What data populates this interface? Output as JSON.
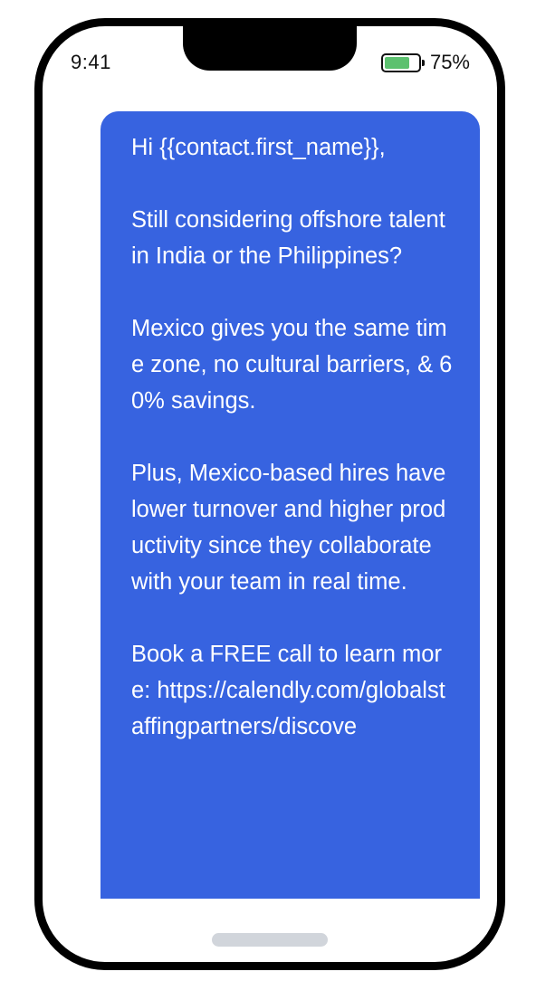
{
  "status_bar": {
    "time": "9:41",
    "battery_percent_label": "75%",
    "battery_level": 0.75,
    "battery_color": "#5cc16f"
  },
  "message": {
    "bubble_color": "#3763e0",
    "paragraphs": [
      "Hi {{contact.first_name}},",
      "Still considering offshore talent in India or the Philippines?",
      "Mexico gives you the same time zone, no cultural barriers, & 60% savings.",
      "Plus, Mexico-based hires have lower turnover and higher productivity since they collaborate with your team in real time.",
      "Book a FREE call to learn more: https://calendly.com/globalstaffingpartners/discove"
    ]
  }
}
